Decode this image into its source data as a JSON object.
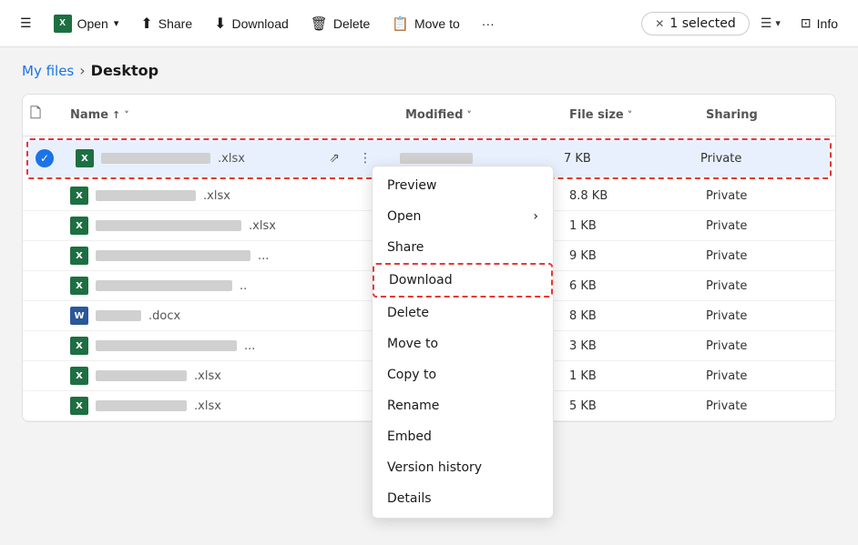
{
  "toolbar": {
    "hamburger": "☰",
    "open_label": "Open",
    "share_label": "Share",
    "download_label": "Download",
    "delete_label": "Delete",
    "move_to_label": "Move to",
    "more_label": "···",
    "selected_text": "1 selected",
    "info_label": "Info"
  },
  "breadcrumb": {
    "parent": "My files",
    "separator": "›",
    "current": "Desktop"
  },
  "files_table": {
    "headers": {
      "name": "Name",
      "modified": "Modified",
      "file_size": "File size",
      "sharing": "Sharing"
    },
    "rows": [
      {
        "id": 1,
        "type": "xlsx",
        "name": ".xlsx",
        "blurred_width": 120,
        "modified": "7 KB",
        "sharing": "Private",
        "selected": true
      },
      {
        "id": 2,
        "type": "xlsx",
        "name": ".xlsx",
        "blurred_width": 110,
        "modified": "8.8 KB",
        "sharing": "Private",
        "selected": false
      },
      {
        "id": 3,
        "type": "xlsx",
        "name": ".xlsx",
        "blurred_width": 160,
        "modified": "1 KB",
        "sharing": "Private",
        "selected": false
      },
      {
        "id": 4,
        "type": "xlsx",
        "name": "...",
        "blurred_width": 180,
        "modified": "9 KB",
        "sharing": "Private",
        "selected": false
      },
      {
        "id": 5,
        "type": "xlsx",
        "name": "..",
        "blurred_width": 160,
        "modified": "6 KB",
        "sharing": "Private",
        "selected": false
      },
      {
        "id": 6,
        "type": "docx",
        "name": ".docx",
        "blurred_width": 50,
        "modified": "8 KB",
        "sharing": "Private",
        "selected": false
      },
      {
        "id": 7,
        "type": "xlsx",
        "name": "...",
        "blurred_width": 170,
        "modified": "3 KB",
        "sharing": "Private",
        "selected": false
      },
      {
        "id": 8,
        "type": "xlsx",
        "name": ".xlsx",
        "blurred_width": 100,
        "modified": "1 KB",
        "sharing": "Private",
        "selected": false
      },
      {
        "id": 9,
        "type": "xlsx",
        "name": ".xlsx",
        "blurred_width": 100,
        "modified": "5 KB",
        "sharing": "Private",
        "selected": false
      }
    ]
  },
  "context_menu": {
    "items": [
      {
        "label": "Preview",
        "has_arrow": false
      },
      {
        "label": "Open",
        "has_arrow": true
      },
      {
        "label": "Share",
        "has_arrow": false
      },
      {
        "label": "Download",
        "has_arrow": false,
        "highlight": true
      },
      {
        "label": "Delete",
        "has_arrow": false
      },
      {
        "label": "Move to",
        "has_arrow": false
      },
      {
        "label": "Copy to",
        "has_arrow": false
      },
      {
        "label": "Rename",
        "has_arrow": false
      },
      {
        "label": "Embed",
        "has_arrow": false
      },
      {
        "label": "Version history",
        "has_arrow": false
      },
      {
        "label": "Details",
        "has_arrow": false
      }
    ]
  },
  "icons": {
    "excel": "X",
    "word": "W",
    "file": "🗋",
    "share": "⬆",
    "download_arrow": "⬇",
    "delete": "🗑",
    "move": "📋",
    "info": "ℹ",
    "check": "✓",
    "close": "✕",
    "chevron_right": "›",
    "chevron_down": "˅",
    "sort_asc": "↑",
    "share_link": "⇗",
    "more_vert": "⋮",
    "hamburger": "☰",
    "view_list": "☰",
    "monitor": "⊡"
  }
}
